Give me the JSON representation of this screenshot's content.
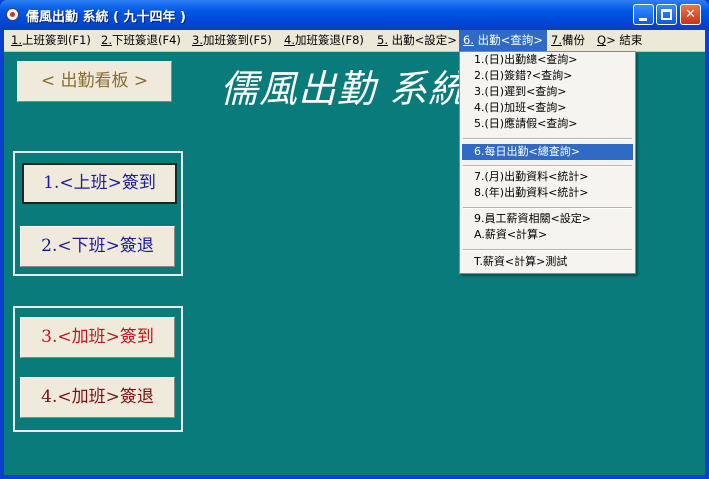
{
  "window": {
    "title": "儒風出勤 系統 ( 九十四年 )"
  },
  "menubar": [
    {
      "key": "1.",
      "label": "上班簽到(F1)"
    },
    {
      "key": "2.",
      "label": "下班簽退(F4)"
    },
    {
      "key": "3.",
      "label": "加班簽到(F5)"
    },
    {
      "key": "4.",
      "label": "加班簽退(F8)"
    },
    {
      "key": "5.",
      "label": " 出勤<設定>"
    },
    {
      "key": "6.",
      "label": " 出勤<查詢>"
    },
    {
      "key": "7.",
      "label": "備份"
    },
    {
      "key": "Q",
      "label": "> 結束"
    }
  ],
  "board_button": "< 出勤看板 >",
  "big_title": "儒風出勤 系統",
  "buttons": {
    "clock_in": "1.<上班>簽到",
    "clock_out": "2.<下班>簽退",
    "ot_in": "3.<加班>簽到",
    "ot_out": "4.<加班>簽退"
  },
  "dropdown": [
    "1.(日)出勤總<查詢>",
    "2.(日)簽錯?<查詢>",
    "3.(日)遲到<查詢>",
    "4.(日)加班<查詢>",
    "5.(日)應請假<查詢>",
    "6.每日出勤<總查詢>",
    "7.(月)出勤資料<統計>",
    "8.(年)出勤資料<統計>",
    "9.員工薪資相關<設定>",
    "A.薪資<計算>",
    "T.薪資<計算>測試"
  ]
}
